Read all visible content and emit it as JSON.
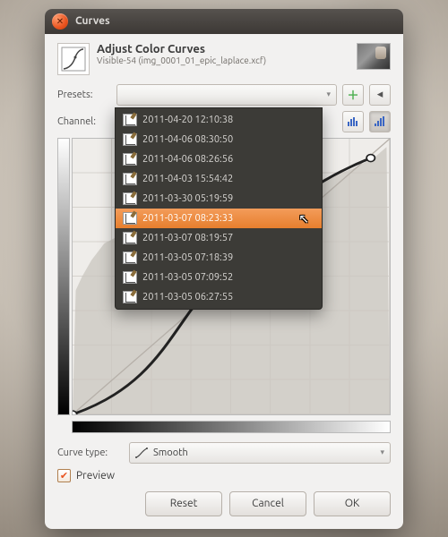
{
  "window": {
    "title": "Curves"
  },
  "header": {
    "title": "Adjust Color Curves",
    "subtitle": "Visible-54 (img_0001_01_epic_laplace.xcf)"
  },
  "labels": {
    "presets": "Presets:",
    "channel": "Channel:",
    "curve_type": "Curve type:",
    "preview": "Preview"
  },
  "curve_type": {
    "selected": "Smooth"
  },
  "buttons": {
    "reset": "Reset",
    "cancel": "Cancel",
    "ok": "OK"
  },
  "presets_dropdown": {
    "items": [
      "2011-04-20 12:10:38",
      "2011-04-06 08:30:50",
      "2011-04-06 08:26:56",
      "2011-04-03 15:54:42",
      "2011-03-30 05:19:59",
      "2011-03-07 08:23:33",
      "2011-03-07 08:19:57",
      "2011-03-05 07:18:39",
      "2011-03-05 07:09:52",
      "2011-03-05 06:27:55"
    ],
    "selected_index": 5
  },
  "preview_checked": true,
  "colors": {
    "accent": "#e95420"
  }
}
